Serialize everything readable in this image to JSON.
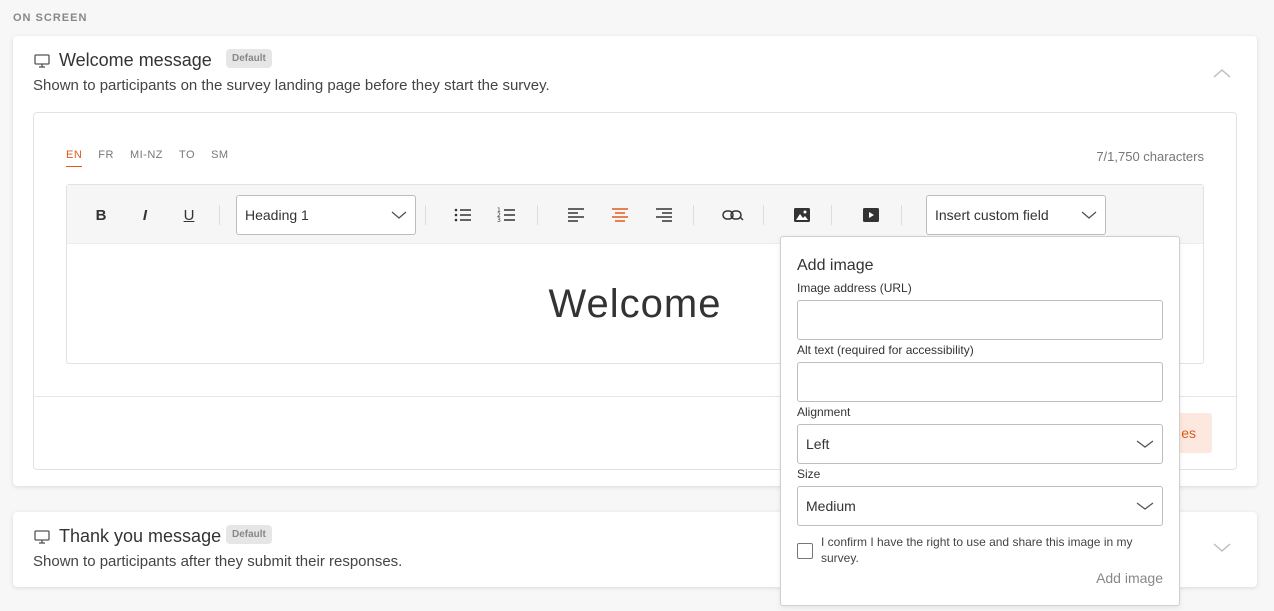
{
  "section_label": "ON SCREEN",
  "welcome": {
    "title": "Welcome message",
    "badge": "Default",
    "description": "Shown to participants on the survey landing page before they start the survey.",
    "languages": [
      "EN",
      "FR",
      "MI-NZ",
      "TO",
      "SM"
    ],
    "active_language": "EN",
    "char_count": "7/1,750 characters",
    "heading_select": "Heading 1",
    "custom_field_select": "Insert custom field",
    "content": "Welcome",
    "save_label": "Save changes",
    "save_visible": "es"
  },
  "thanks": {
    "title": "Thank you message",
    "badge": "Default",
    "description": "Shown to participants after they submit their responses."
  },
  "toolbar": {
    "bold": "B",
    "italic": "I",
    "underline": "U"
  },
  "add_image": {
    "title": "Add image",
    "url_label": "Image address (URL)",
    "alt_label": "Alt text (required for accessibility)",
    "alignment_label": "Alignment",
    "alignment_value": "Left",
    "size_label": "Size",
    "size_value": "Medium",
    "confirm_label": "I confirm I have the right to use and share this image in my survey.",
    "submit_label": "Add image"
  },
  "colors": {
    "accent": "#e05a1b",
    "accent_light": "#fde8df"
  }
}
